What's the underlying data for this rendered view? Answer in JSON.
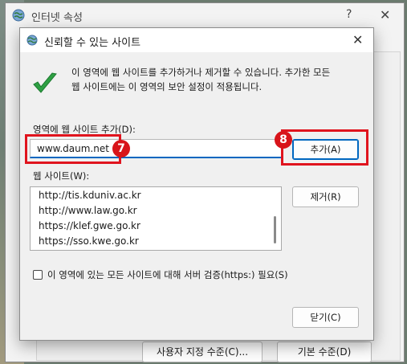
{
  "parent_window": {
    "title": "인터넷 속성",
    "help_glyph": "?",
    "close_glyph": "✕",
    "custom_level_label": "사용자 지정 수준(C)...",
    "default_level_label": "기본 수준(D)"
  },
  "dialog": {
    "title": "신뢰할 수 있는 사이트",
    "close_glyph": "✕",
    "description_line1": "이 영역에 웹 사이트를 추가하거나 제거할 수 있습니다. 추가한 모든",
    "description_line2": "웹 사이트에는 이 영역의 보안 설정이 적용됩니다.",
    "add_field_label": "영역에 웹 사이트 추가(D):",
    "add_field_value": "www.daum.net",
    "add_button": "추가(A)",
    "sites_label": "웹 사이트(W):",
    "sites": [
      "http://tis.kduniv.ac.kr",
      "http://www.law.go.kr",
      "https://klef.gwe.go.kr",
      "https://sso.kwe.go.kr"
    ],
    "remove_button": "제거(R)",
    "https_check_label": "이 영역에 있는 모든 사이트에 대해 서버 검증(https:) 필요(S)",
    "close_button": "닫기(C)"
  },
  "annotations": {
    "step7": "7",
    "step8": "8",
    "color": "#e0141e"
  },
  "colors": {
    "accent": "#0067c0",
    "check_green": "#2ea043"
  }
}
